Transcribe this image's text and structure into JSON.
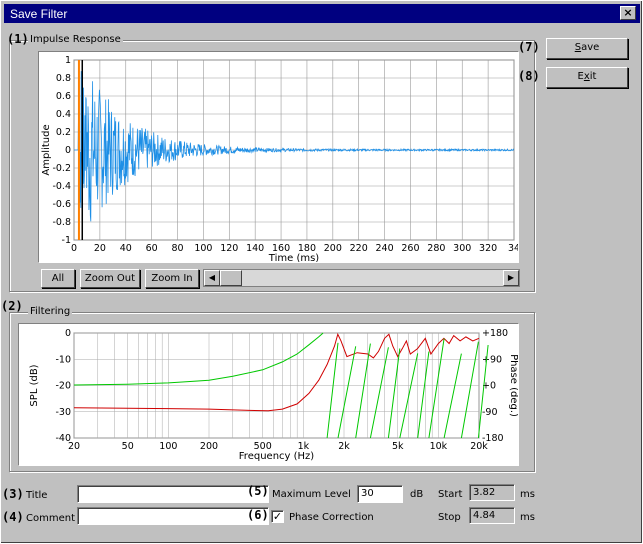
{
  "window": {
    "title": "Save Filter",
    "close_glyph": "×"
  },
  "impulse": {
    "marker": "(1)",
    "group_label": "Impulse Response",
    "buttons": {
      "all": "All",
      "zoom_out": "Zoom Out",
      "zoom_in": "Zoom In"
    },
    "scroll_left": "◀",
    "scroll_right": "▶"
  },
  "filtering": {
    "marker": "(2)",
    "group_label": "Filtering"
  },
  "actions": {
    "save_marker": "(7)",
    "save_label": "Save",
    "save_accel": "S",
    "save_rest": "ave",
    "exit_marker": "(8)",
    "exit_label": "Exit",
    "exit_pre": "E",
    "exit_accel": "x",
    "exit_rest": "it"
  },
  "form": {
    "title_marker": "(3)",
    "title_label": "Title",
    "title_value": "",
    "comment_marker": "(4)",
    "comment_label": "Comment",
    "comment_value": "",
    "maxlevel_marker": "(5)",
    "maxlevel_label": "Maximum Level",
    "maxlevel_value": "30",
    "maxlevel_unit": "dB",
    "phase_marker": "(6)",
    "phase_label": "Phase Correction",
    "phase_checked": "✓",
    "start_label": "Start",
    "start_value": "3.82",
    "start_unit": "ms",
    "stop_label": "Stop",
    "stop_value": "4.84",
    "stop_unit": "ms"
  },
  "chart_data": [
    {
      "type": "line",
      "xlabel": "Time (ms)",
      "ylabel": "Amplitude",
      "xlim": [
        0,
        340
      ],
      "ylim": [
        -1,
        1
      ],
      "x_ticks": [
        "0",
        "20",
        "40",
        "60",
        "80",
        "100",
        "120",
        "140",
        "160",
        "180",
        "200",
        "220",
        "240",
        "260",
        "280",
        "300",
        "320",
        "34"
      ],
      "y_ticks": [
        "1",
        "0.8",
        "0.6",
        "0.4",
        "0.2",
        "0",
        "-0.2",
        "-0.4",
        "-0.6",
        "-0.8",
        "-1"
      ],
      "grid": true,
      "colors": {
        "signal": "#1e8fe6",
        "marker_start": "#ff8000",
        "marker_stop": "#000000"
      },
      "start_marker_ms": 3.82,
      "stop_marker_ms": 4.84,
      "envelope": {
        "peak": 0.95,
        "peak_time_ms": 10,
        "decay_ms": 32,
        "floor": 0.01
      }
    },
    {
      "type": "line",
      "xlabel": "Frequency (Hz)",
      "ylabel": "SPL (dB)",
      "y2label": "Phase (deg.)",
      "xlog": true,
      "xlim": [
        20,
        20000
      ],
      "ylim": [
        -40,
        0
      ],
      "y2lim": [
        -180,
        180
      ],
      "x_ticks": [
        "20",
        "50",
        "100",
        "200",
        "500",
        "1k",
        "2k",
        "5k",
        "10k",
        "20k"
      ],
      "x_tick_values": [
        20,
        50,
        100,
        200,
        500,
        1000,
        2000,
        5000,
        10000,
        20000
      ],
      "y_ticks": [
        "0",
        "-10",
        "-20",
        "-30",
        "-40"
      ],
      "y2_ticks": [
        "+180",
        "+90",
        "+0",
        "-90",
        "-180"
      ],
      "grid": true,
      "series": [
        {
          "color": "#00c800",
          "points": [
            [
              20,
              -19.8
            ],
            [
              50,
              -19.5
            ],
            [
              100,
              -19
            ],
            [
              200,
              -18
            ],
            [
              300,
              -16.5
            ],
            [
              500,
              -14
            ],
            [
              700,
              -11
            ],
            [
              900,
              -8
            ],
            [
              1100,
              -4.5
            ],
            [
              1300,
              -1.5
            ],
            [
              1400,
              0
            ]
          ]
        },
        {
          "color": "#d00000",
          "points": [
            [
              20,
              -28.5
            ],
            [
              100,
              -28.8
            ],
            [
              200,
              -29
            ],
            [
              400,
              -29.5
            ],
            [
              550,
              -29.6
            ],
            [
              700,
              -29
            ],
            [
              900,
              -27
            ],
            [
              1100,
              -23
            ],
            [
              1300,
              -18
            ],
            [
              1500,
              -12
            ],
            [
              1700,
              -5
            ],
            [
              1800,
              -0.5
            ],
            [
              1900,
              -3
            ],
            [
              2100,
              -9
            ],
            [
              2500,
              -7.5
            ],
            [
              3000,
              -8
            ],
            [
              3300,
              -9.5
            ],
            [
              3600,
              -7
            ],
            [
              4000,
              -2
            ],
            [
              4300,
              -0.5
            ],
            [
              4600,
              -5
            ],
            [
              5000,
              -9
            ],
            [
              5400,
              -6
            ],
            [
              5800,
              -3
            ],
            [
              6200,
              -8
            ],
            [
              7000,
              -6
            ],
            [
              8000,
              -2
            ],
            [
              8800,
              -8
            ],
            [
              10000,
              -4
            ],
            [
              11000,
              -2
            ],
            [
              12000,
              -4
            ],
            [
              13000,
              -1
            ],
            [
              14500,
              -3
            ],
            [
              16000,
              -1.5
            ],
            [
              18000,
              -3
            ],
            [
              20000,
              -2
            ]
          ]
        }
      ]
    }
  ]
}
